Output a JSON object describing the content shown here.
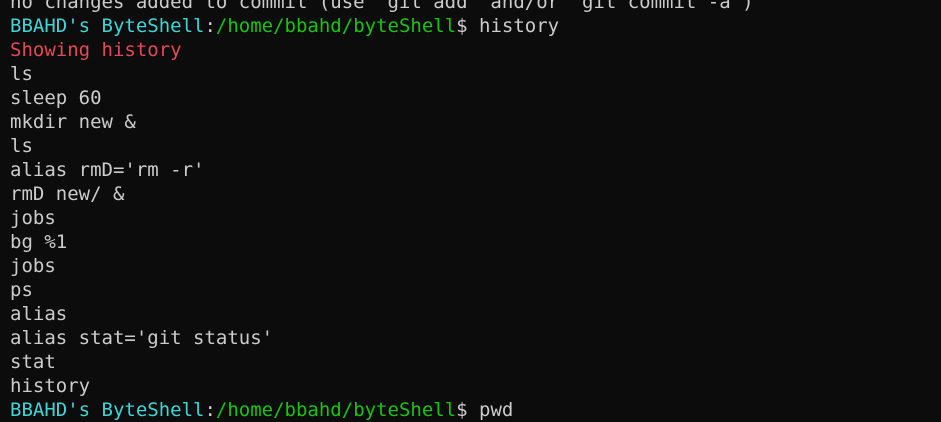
{
  "terminal": {
    "top_partial": "no changes added to commit (use \"git add\" and/or \"git commit -a\")",
    "prompt1": {
      "user": "BBAHD's ByteShell",
      "sep": ":",
      "path": "/home/bbahd/byteShell",
      "dollar": "$",
      "command": " history"
    },
    "message": "Showing history",
    "history": [
      "ls",
      "sleep 60",
      "mkdir new &",
      "ls",
      "alias rmD='rm -r'",
      "rmD new/ &",
      "jobs",
      "bg %1",
      "jobs",
      "ps",
      "alias",
      "alias stat='git status'",
      "stat",
      "history"
    ],
    "prompt2": {
      "user": "BBAHD's ByteShell",
      "sep": ":",
      "path": "/home/bbahd/byteShell",
      "dollar": "$",
      "command": " pwd"
    }
  },
  "colors": {
    "background": "#0c0c0c",
    "text": "#cccccc",
    "prompt_user": "#3dd6d6",
    "prompt_path": "#16c60c",
    "message": "#e74856"
  }
}
